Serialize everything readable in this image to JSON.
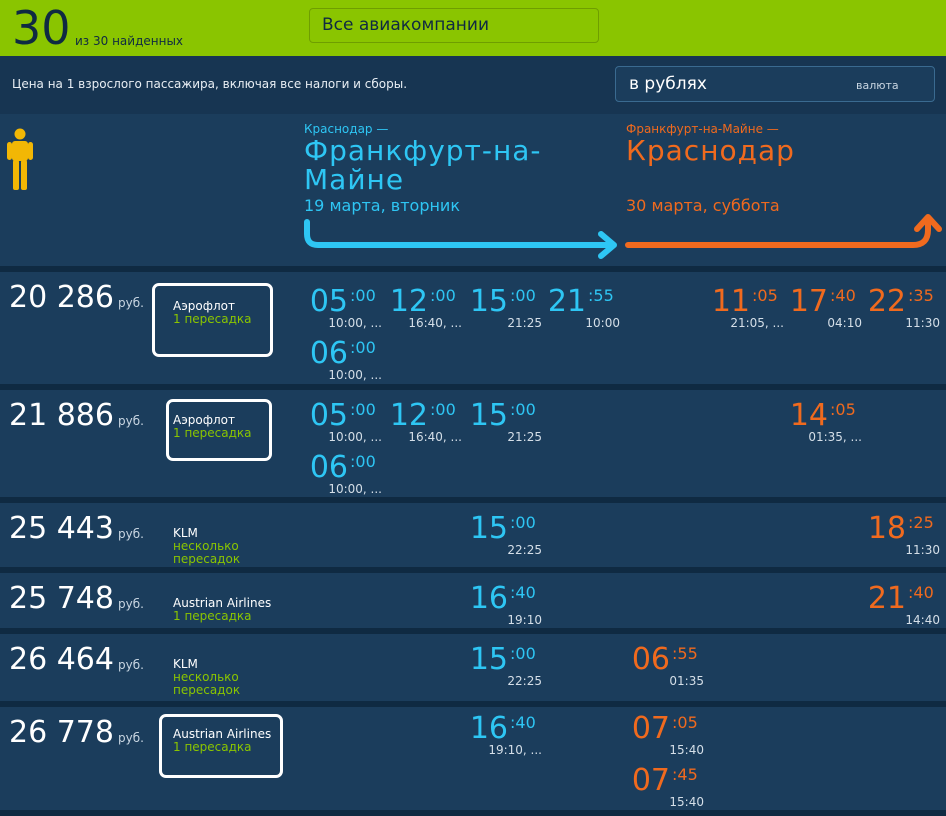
{
  "header": {
    "count": "30",
    "count_sub": "из 30 найденных",
    "airline_filter": "Все авиакомпании"
  },
  "info": {
    "price_note": "Цена на 1 взрослого пассажира, включая все налоги и сборы.",
    "currency_value": "в рублях",
    "currency_label": "валюта"
  },
  "route": {
    "outbound_from": "Краснодар —",
    "outbound_to": "Франкфурт-на-Майне",
    "outbound_date": "19 марта, вторник",
    "return_from": "Франкфурт-на-Майне —",
    "return_to": "Краснодар",
    "return_date": "30 марта, суббота"
  },
  "colors": {
    "outbound": "#2ec6f4",
    "return": "#f06a1e",
    "accent": "#8ac500"
  },
  "results": [
    {
      "price": "20 286",
      "currency": "руб.",
      "airline": "Аэрофлот",
      "stops": "1 пересадка",
      "outbound": [
        {
          "h": "05",
          "m": ":00",
          "a": "10:00, ..."
        },
        {
          "h": "12",
          "m": ":00",
          "a": "16:40, ..."
        },
        {
          "h": "15",
          "m": ":00",
          "a": "21:25"
        },
        {
          "h": "21",
          "m": ":55",
          "a": "10:00"
        },
        {
          "h": "06",
          "m": ":00",
          "a": "10:00, ..."
        }
      ],
      "return": [
        {
          "h": "11",
          "m": ":05",
          "a": "21:05, ..."
        },
        {
          "h": "17",
          "m": ":40",
          "a": "04:10"
        },
        {
          "h": "22",
          "m": ":35",
          "a": "11:30"
        }
      ]
    },
    {
      "price": "21 886",
      "currency": "руб.",
      "airline": "Аэрофлот",
      "stops": "1 пересадка",
      "outbound": [
        {
          "h": "05",
          "m": ":00",
          "a": "10:00, ..."
        },
        {
          "h": "12",
          "m": ":00",
          "a": "16:40, ..."
        },
        {
          "h": "15",
          "m": ":00",
          "a": "21:25"
        },
        {
          "h": "06",
          "m": ":00",
          "a": "10:00, ..."
        }
      ],
      "return": [
        {
          "h": "14",
          "m": ":05",
          "a": "01:35, ..."
        }
      ]
    },
    {
      "price": "25 443",
      "currency": "руб.",
      "airline": "KLM",
      "stops": "несколько пересадок",
      "outbound": [
        {
          "h": "15",
          "m": ":00",
          "a": "22:25"
        }
      ],
      "return": [
        {
          "h": "18",
          "m": ":25",
          "a": "11:30"
        }
      ]
    },
    {
      "price": "25 748",
      "currency": "руб.",
      "airline": "Austrian Airlines",
      "stops": "1 пересадка",
      "outbound": [
        {
          "h": "16",
          "m": ":40",
          "a": "19:10"
        }
      ],
      "return": [
        {
          "h": "21",
          "m": ":40",
          "a": "14:40"
        }
      ]
    },
    {
      "price": "26 464",
      "currency": "руб.",
      "airline": "KLM",
      "stops": "несколько пересадок",
      "outbound": [
        {
          "h": "15",
          "m": ":00",
          "a": "22:25"
        }
      ],
      "return": [
        {
          "h": "06",
          "m": ":55",
          "a": "01:35"
        }
      ]
    },
    {
      "price": "26 778",
      "currency": "руб.",
      "airline": "Austrian Airlines",
      "stops": "1 пересадка",
      "outbound": [
        {
          "h": "16",
          "m": ":40",
          "a": "19:10, ..."
        }
      ],
      "return": [
        {
          "h": "07",
          "m": ":05",
          "a": "15:40"
        },
        {
          "h": "07",
          "m": ":45",
          "a": "15:40"
        }
      ]
    }
  ]
}
